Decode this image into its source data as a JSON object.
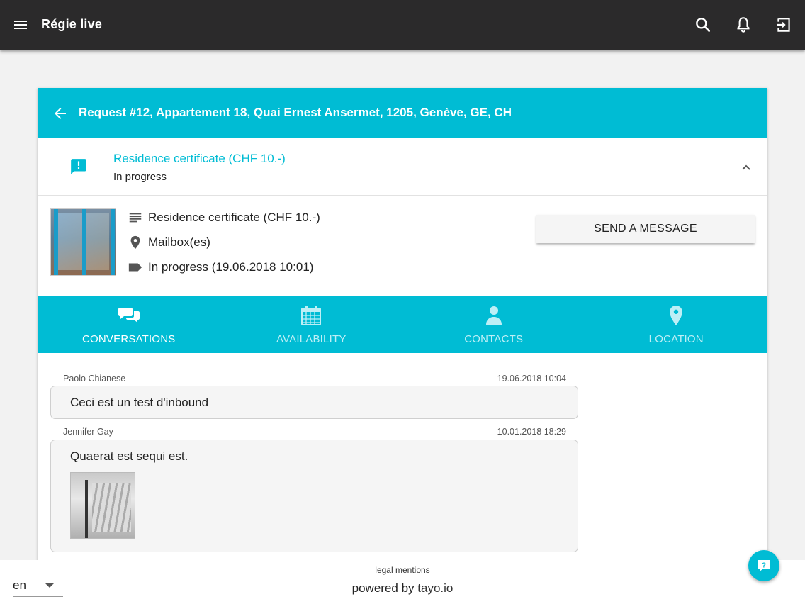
{
  "appbar": {
    "title": "Régie live",
    "icons": [
      "menu-icon",
      "search-icon",
      "bell-icon",
      "logout-icon"
    ]
  },
  "request": {
    "header_title": "Request #12, Appartement 18, Quai Ernest Ansermet, 1205, Genève, GE, CH",
    "summary_title": "Residence certificate (CHF 10.-)",
    "summary_status": "In progress",
    "details": {
      "type": "Residence certificate (CHF 10.-)",
      "location": "Mailbox(es)",
      "status": "In progress (19.06.2018 10:01)"
    },
    "send_button": "SEND A MESSAGE"
  },
  "tabs": [
    {
      "label": "CONVERSATIONS",
      "icon": "chat-icon",
      "active": true
    },
    {
      "label": "AVAILABILITY",
      "icon": "calendar-icon",
      "active": false
    },
    {
      "label": "CONTACTS",
      "icon": "person-icon",
      "active": false
    },
    {
      "label": "LOCATION",
      "icon": "location-pin-icon",
      "active": false
    }
  ],
  "messages": [
    {
      "author": "Paolo Chianese",
      "date": "19.06.2018 10:04",
      "text": "Ceci est un test d'inbound",
      "has_attachment": false
    },
    {
      "author": "Jennifer Gay",
      "date": "10.01.2018 18:29",
      "text": "Quaerat est sequi est.",
      "has_attachment": true
    }
  ],
  "footer": {
    "language": "en",
    "legal": "legal mentions",
    "powered_prefix": "powered by ",
    "powered_link": "tayo.io"
  },
  "colors": {
    "appbar": "#2b2a2b",
    "accent": "#00bcd4",
    "background": "#f2f2f2"
  }
}
